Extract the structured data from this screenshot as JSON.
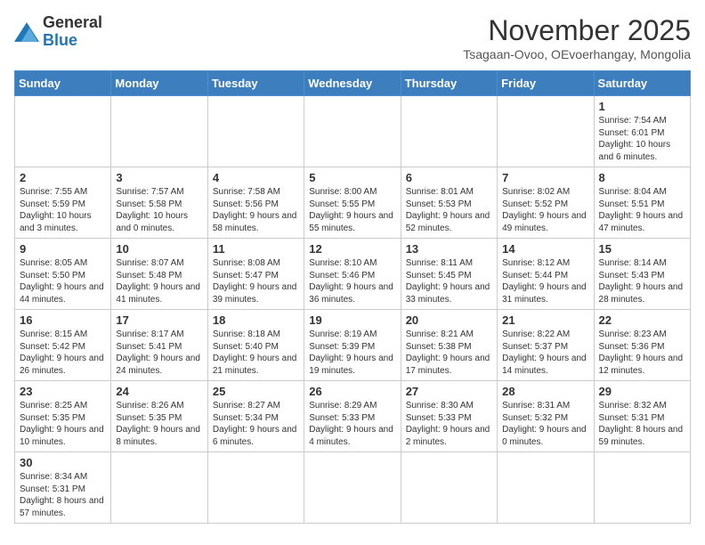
{
  "logo": {
    "text_general": "General",
    "text_blue": "Blue"
  },
  "header": {
    "title": "November 2025",
    "subtitle": "Tsagaan-Ovoo, OEvoerhangay, Mongolia"
  },
  "weekdays": [
    "Sunday",
    "Monday",
    "Tuesday",
    "Wednesday",
    "Thursday",
    "Friday",
    "Saturday"
  ],
  "weeks": [
    [
      {
        "day": "",
        "info": ""
      },
      {
        "day": "",
        "info": ""
      },
      {
        "day": "",
        "info": ""
      },
      {
        "day": "",
        "info": ""
      },
      {
        "day": "",
        "info": ""
      },
      {
        "day": "",
        "info": ""
      },
      {
        "day": "1",
        "info": "Sunrise: 7:54 AM\nSunset: 6:01 PM\nDaylight: 10 hours and 6 minutes."
      }
    ],
    [
      {
        "day": "2",
        "info": "Sunrise: 7:55 AM\nSunset: 5:59 PM\nDaylight: 10 hours and 3 minutes."
      },
      {
        "day": "3",
        "info": "Sunrise: 7:57 AM\nSunset: 5:58 PM\nDaylight: 10 hours and 0 minutes."
      },
      {
        "day": "4",
        "info": "Sunrise: 7:58 AM\nSunset: 5:56 PM\nDaylight: 9 hours and 58 minutes."
      },
      {
        "day": "5",
        "info": "Sunrise: 8:00 AM\nSunset: 5:55 PM\nDaylight: 9 hours and 55 minutes."
      },
      {
        "day": "6",
        "info": "Sunrise: 8:01 AM\nSunset: 5:53 PM\nDaylight: 9 hours and 52 minutes."
      },
      {
        "day": "7",
        "info": "Sunrise: 8:02 AM\nSunset: 5:52 PM\nDaylight: 9 hours and 49 minutes."
      },
      {
        "day": "8",
        "info": "Sunrise: 8:04 AM\nSunset: 5:51 PM\nDaylight: 9 hours and 47 minutes."
      }
    ],
    [
      {
        "day": "9",
        "info": "Sunrise: 8:05 AM\nSunset: 5:50 PM\nDaylight: 9 hours and 44 minutes."
      },
      {
        "day": "10",
        "info": "Sunrise: 8:07 AM\nSunset: 5:48 PM\nDaylight: 9 hours and 41 minutes."
      },
      {
        "day": "11",
        "info": "Sunrise: 8:08 AM\nSunset: 5:47 PM\nDaylight: 9 hours and 39 minutes."
      },
      {
        "day": "12",
        "info": "Sunrise: 8:10 AM\nSunset: 5:46 PM\nDaylight: 9 hours and 36 minutes."
      },
      {
        "day": "13",
        "info": "Sunrise: 8:11 AM\nSunset: 5:45 PM\nDaylight: 9 hours and 33 minutes."
      },
      {
        "day": "14",
        "info": "Sunrise: 8:12 AM\nSunset: 5:44 PM\nDaylight: 9 hours and 31 minutes."
      },
      {
        "day": "15",
        "info": "Sunrise: 8:14 AM\nSunset: 5:43 PM\nDaylight: 9 hours and 28 minutes."
      }
    ],
    [
      {
        "day": "16",
        "info": "Sunrise: 8:15 AM\nSunset: 5:42 PM\nDaylight: 9 hours and 26 minutes."
      },
      {
        "day": "17",
        "info": "Sunrise: 8:17 AM\nSunset: 5:41 PM\nDaylight: 9 hours and 24 minutes."
      },
      {
        "day": "18",
        "info": "Sunrise: 8:18 AM\nSunset: 5:40 PM\nDaylight: 9 hours and 21 minutes."
      },
      {
        "day": "19",
        "info": "Sunrise: 8:19 AM\nSunset: 5:39 PM\nDaylight: 9 hours and 19 minutes."
      },
      {
        "day": "20",
        "info": "Sunrise: 8:21 AM\nSunset: 5:38 PM\nDaylight: 9 hours and 17 minutes."
      },
      {
        "day": "21",
        "info": "Sunrise: 8:22 AM\nSunset: 5:37 PM\nDaylight: 9 hours and 14 minutes."
      },
      {
        "day": "22",
        "info": "Sunrise: 8:23 AM\nSunset: 5:36 PM\nDaylight: 9 hours and 12 minutes."
      }
    ],
    [
      {
        "day": "23",
        "info": "Sunrise: 8:25 AM\nSunset: 5:35 PM\nDaylight: 9 hours and 10 minutes."
      },
      {
        "day": "24",
        "info": "Sunrise: 8:26 AM\nSunset: 5:35 PM\nDaylight: 9 hours and 8 minutes."
      },
      {
        "day": "25",
        "info": "Sunrise: 8:27 AM\nSunset: 5:34 PM\nDaylight: 9 hours and 6 minutes."
      },
      {
        "day": "26",
        "info": "Sunrise: 8:29 AM\nSunset: 5:33 PM\nDaylight: 9 hours and 4 minutes."
      },
      {
        "day": "27",
        "info": "Sunrise: 8:30 AM\nSunset: 5:33 PM\nDaylight: 9 hours and 2 minutes."
      },
      {
        "day": "28",
        "info": "Sunrise: 8:31 AM\nSunset: 5:32 PM\nDaylight: 9 hours and 0 minutes."
      },
      {
        "day": "29",
        "info": "Sunrise: 8:32 AM\nSunset: 5:31 PM\nDaylight: 8 hours and 59 minutes."
      }
    ],
    [
      {
        "day": "30",
        "info": "Sunrise: 8:34 AM\nSunset: 5:31 PM\nDaylight: 8 hours and 57 minutes."
      },
      {
        "day": "",
        "info": ""
      },
      {
        "day": "",
        "info": ""
      },
      {
        "day": "",
        "info": ""
      },
      {
        "day": "",
        "info": ""
      },
      {
        "day": "",
        "info": ""
      },
      {
        "day": "",
        "info": ""
      }
    ]
  ]
}
